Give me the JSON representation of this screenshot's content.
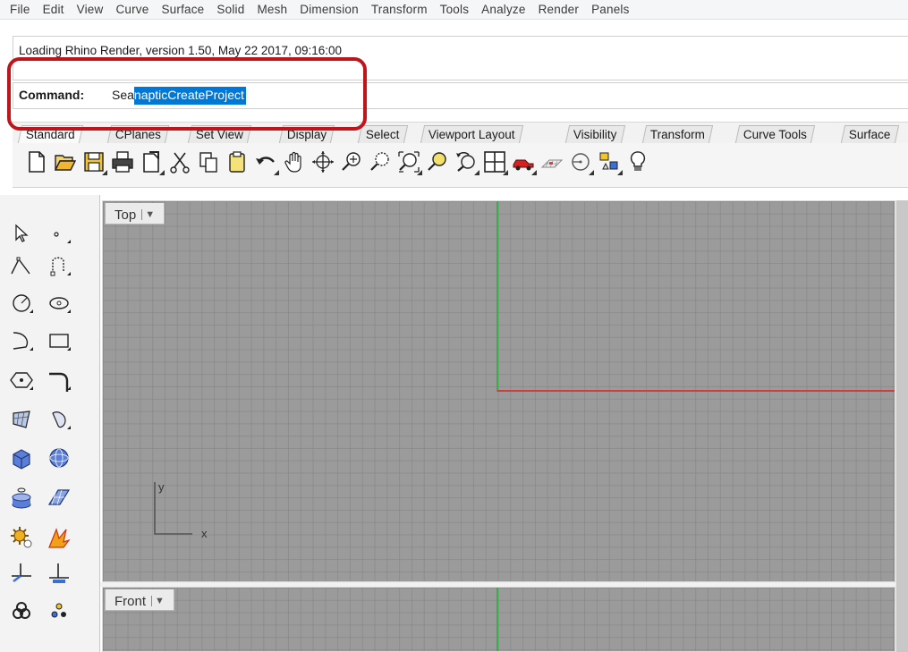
{
  "menu": [
    "File",
    "Edit",
    "View",
    "Curve",
    "Surface",
    "Solid",
    "Mesh",
    "Dimension",
    "Transform",
    "Tools",
    "Analyze",
    "Render",
    "Panels"
  ],
  "command_history": {
    "line1": "Loading Rhino Render, version 1.50, May 22 2017, 09:16:00"
  },
  "command_prompt": {
    "label": "Command:",
    "typed_prefix": "Sea",
    "selected_suffix": "napticCreateProject"
  },
  "toolbar_tabs": [
    "Standard",
    "CPlanes",
    "Set View",
    "Display",
    "Select",
    "Viewport Layout",
    "Visibility",
    "Transform",
    "Curve Tools",
    "Surface"
  ],
  "active_tab": "Standard",
  "tool_icons": [
    "new-icon",
    "open-icon",
    "save-icon",
    "print-icon",
    "import-icon",
    "cut-icon",
    "copy-icon",
    "paste-icon",
    "undo-icon",
    "pan-icon",
    "rotate-icon",
    "zoom-icon",
    "zoom-window-icon",
    "zoom-extents-icon",
    "zoom-selected-icon",
    "rotate-view-icon",
    "four-viewports-icon",
    "car-icon",
    "material-icon",
    "circle-tool-icon",
    "shapes-icon",
    "light-icon"
  ],
  "viewports": {
    "top": {
      "label": "Top",
      "axis_x": "x",
      "axis_y": "y"
    },
    "front": {
      "label": "Front"
    }
  },
  "colors": {
    "highlight_border": "#c0141c",
    "selection": "#0078d7",
    "axis_x": "#c84040",
    "axis_y": "#35b048",
    "viewport_bg": "#9b9b9b"
  }
}
